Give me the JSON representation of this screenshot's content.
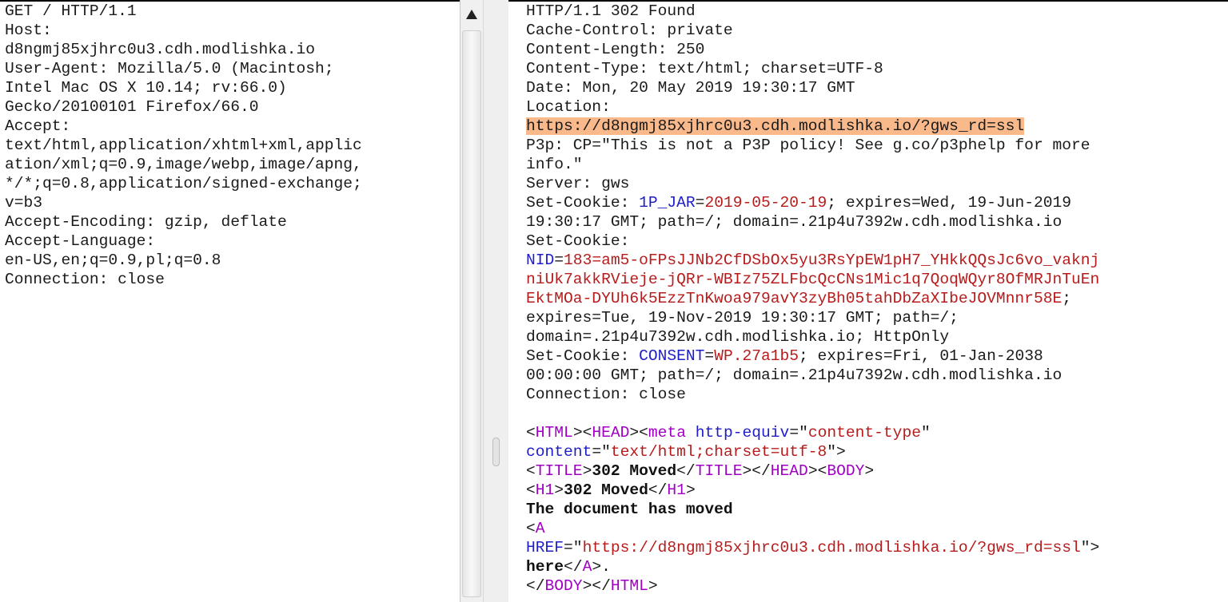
{
  "request": {
    "lines": [
      "GET / HTTP/1.1",
      "Host:",
      "d8ngmj85xjhrc0u3.cdh.modlishka.io",
      "User-Agent: Mozilla/5.0 (Macintosh;",
      "Intel Mac OS X 10.14; rv:66.0)",
      "Gecko/20100101 Firefox/66.0",
      "Accept:",
      "text/html,application/xhtml+xml,applic",
      "ation/xml;q=0.9,image/webp,image/apng,",
      "*/*;q=0.8,application/signed-exchange;",
      "v=b3",
      "Accept-Encoding: gzip, deflate",
      "Accept-Language:",
      "en-US,en;q=0.9,pl;q=0.8",
      "Connection: close"
    ]
  },
  "response": {
    "lines": [
      [
        {
          "t": "HTTP/1.1 302 Found"
        }
      ],
      [
        {
          "t": "Cache-Control: private"
        }
      ],
      [
        {
          "t": "Content-Length: 250"
        }
      ],
      [
        {
          "t": "Content-Type: text/html; charset=UTF-8"
        }
      ],
      [
        {
          "t": "Date: Mon, 20 May 2019 19:30:17 GMT"
        }
      ],
      [
        {
          "t": "Location:"
        }
      ],
      [
        {
          "t": "https://d8ngmj85xjhrc0u3.cdh.modlishka.io/?gws_rd=ssl",
          "c": "hl"
        }
      ],
      [
        {
          "t": "P3p: CP=\"This is not a P3P policy! See g.co/p3phelp for more"
        }
      ],
      [
        {
          "t": "info.\""
        }
      ],
      [
        {
          "t": "Server: gws"
        }
      ],
      [
        {
          "t": "Set-Cookie: "
        },
        {
          "t": "1P_JAR",
          "c": "k"
        },
        {
          "t": "="
        },
        {
          "t": "2019-05-20-19",
          "c": "v"
        },
        {
          "t": "; expires=Wed, 19-Jun-2019"
        }
      ],
      [
        {
          "t": "19:30:17 GMT; path=/; domain=.21p4u7392w.cdh.modlishka.io"
        }
      ],
      [
        {
          "t": "Set-Cookie:"
        }
      ],
      [
        {
          "t": "NID",
          "c": "k"
        },
        {
          "t": "="
        },
        {
          "t": "183=am5-oFPsJJNb2CfDSbOx5yu3RsYpEW1pH7_YHkkQQsJc6vo_vaknj",
          "c": "v"
        }
      ],
      [
        {
          "t": "niUk7akkRVieje-jQRr-WBIz75ZLFbcQcCNs1Mic1q7QoqWQyr8OfMRJnTuEn",
          "c": "v"
        }
      ],
      [
        {
          "t": "EktMOa-DYUh6k5EzzTnKwoa979avY3zyBh05tahDbZaXIbeJOVMnnr58E",
          "c": "v"
        },
        {
          "t": ";"
        }
      ],
      [
        {
          "t": "expires=Tue, 19-Nov-2019 19:30:17 GMT; path=/;"
        }
      ],
      [
        {
          "t": "domain=.21p4u7392w.cdh.modlishka.io; HttpOnly"
        }
      ],
      [
        {
          "t": "Set-Cookie: "
        },
        {
          "t": "CONSENT",
          "c": "k"
        },
        {
          "t": "="
        },
        {
          "t": "WP.27a1b5",
          "c": "v"
        },
        {
          "t": "; expires=Fri, 01-Jan-2038"
        }
      ],
      [
        {
          "t": "00:00:00 GMT; path=/; domain=.21p4u7392w.cdh.modlishka.io"
        }
      ],
      [
        {
          "t": "Connection: close"
        }
      ],
      [
        {
          "t": ""
        }
      ],
      [
        {
          "t": "<"
        },
        {
          "t": "HTML",
          "c": "t"
        },
        {
          "t": "><"
        },
        {
          "t": "HEAD",
          "c": "t"
        },
        {
          "t": "><"
        },
        {
          "t": "meta",
          "c": "t"
        },
        {
          "t": " "
        },
        {
          "t": "http-equiv",
          "c": "k"
        },
        {
          "t": "=\""
        },
        {
          "t": "content-type",
          "c": "v"
        },
        {
          "t": "\""
        }
      ],
      [
        {
          "t": "content",
          "c": "k"
        },
        {
          "t": "=\""
        },
        {
          "t": "text/html;charset=utf-8",
          "c": "v"
        },
        {
          "t": "\">"
        }
      ],
      [
        {
          "t": "<"
        },
        {
          "t": "TITLE",
          "c": "t"
        },
        {
          "t": ">"
        },
        {
          "t": "302 Moved",
          "c": "b"
        },
        {
          "t": "</"
        },
        {
          "t": "TITLE",
          "c": "t"
        },
        {
          "t": "></"
        },
        {
          "t": "HEAD",
          "c": "t"
        },
        {
          "t": "><"
        },
        {
          "t": "BODY",
          "c": "t"
        },
        {
          "t": ">"
        }
      ],
      [
        {
          "t": "<"
        },
        {
          "t": "H1",
          "c": "t"
        },
        {
          "t": ">"
        },
        {
          "t": "302 Moved",
          "c": "b"
        },
        {
          "t": "</"
        },
        {
          "t": "H1",
          "c": "t"
        },
        {
          "t": ">"
        }
      ],
      [
        {
          "t": "The document has moved",
          "c": "b"
        }
      ],
      [
        {
          "t": "<"
        },
        {
          "t": "A",
          "c": "t"
        }
      ],
      [
        {
          "t": "HREF",
          "c": "k"
        },
        {
          "t": "=\""
        },
        {
          "t": "https://d8ngmj85xjhrc0u3.cdh.modlishka.io/?gws_rd=ssl",
          "c": "v"
        },
        {
          "t": "\">"
        }
      ],
      [
        {
          "t": "here",
          "c": "b"
        },
        {
          "t": "</"
        },
        {
          "t": "A",
          "c": "t"
        },
        {
          "t": ">."
        }
      ],
      [
        {
          "t": "</"
        },
        {
          "t": "BODY",
          "c": "t"
        },
        {
          "t": "></"
        },
        {
          "t": "HTML",
          "c": "t"
        },
        {
          "t": ">"
        }
      ]
    ]
  },
  "icons": {
    "scroll_up": "triangle-up-icon"
  }
}
